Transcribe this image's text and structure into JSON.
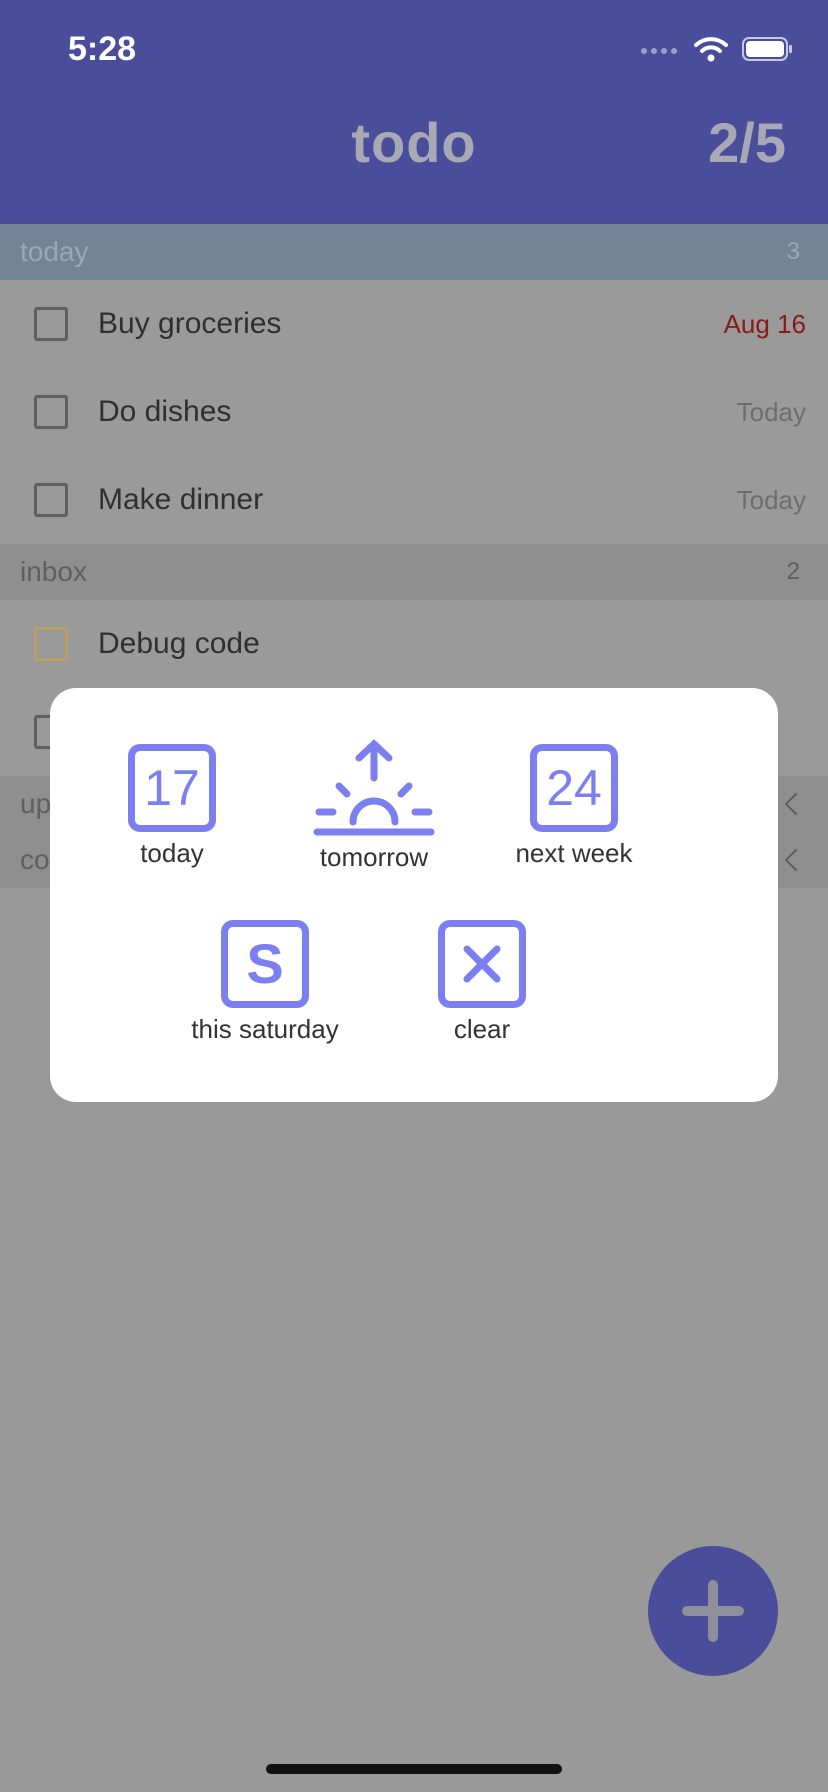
{
  "status": {
    "time": "5:28"
  },
  "header": {
    "title": "todo",
    "counter": "2/5"
  },
  "sections": {
    "today": {
      "label": "today",
      "count": "3"
    },
    "inbox": {
      "label": "inbox",
      "count": "2"
    },
    "upcoming": {
      "label": "up"
    },
    "completed": {
      "label": "co"
    }
  },
  "today_tasks": [
    {
      "label": "Buy groceries",
      "date": "Aug 16"
    },
    {
      "label": "Do dishes",
      "date": "Today"
    },
    {
      "label": "Make dinner",
      "date": "Today"
    }
  ],
  "inbox_tasks": [
    {
      "label": "Debug code"
    }
  ],
  "modal": {
    "options": [
      {
        "label": "today",
        "icon": "calendar-17-icon",
        "number": "17"
      },
      {
        "label": "tomorrow",
        "icon": "sunrise-icon"
      },
      {
        "label": "next week",
        "icon": "calendar-24-icon",
        "number": "24"
      },
      {
        "label": "this saturday",
        "icon": "saturday-s-icon",
        "letter": "S"
      },
      {
        "label": "clear",
        "icon": "clear-x-icon"
      }
    ]
  },
  "colors": {
    "header": "#4a4d9a",
    "accent": "#7b7ff0",
    "overdue": "#8a1a1a",
    "backdrop": "#999999"
  }
}
